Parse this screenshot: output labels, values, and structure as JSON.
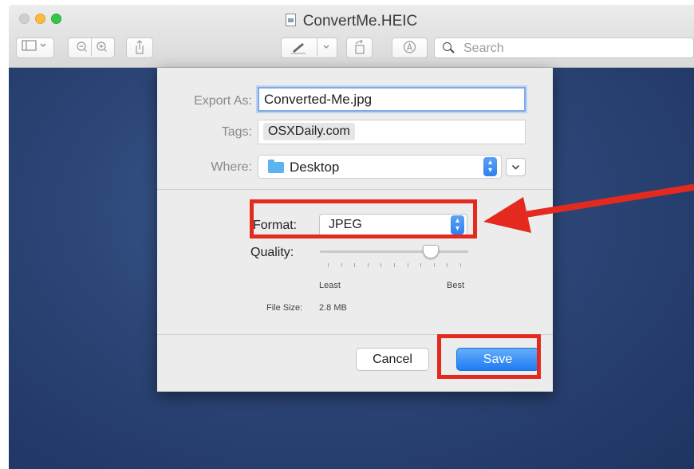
{
  "window": {
    "title": "ConvertMe.HEIC",
    "toolbar": {
      "sidebar_icon": "sidebar-icon",
      "zoom_out_icon": "zoom-out-icon",
      "zoom_in_icon": "zoom-in-icon",
      "share_icon": "share-icon",
      "markup_icon": "pen-icon",
      "rotate_icon": "rotate-icon",
      "annotate_icon": "markup-circle-icon",
      "search_placeholder": "Search"
    }
  },
  "dialog": {
    "export_as_label": "Export As:",
    "export_as_value": "Converted-Me.jpg",
    "tags_label": "Tags:",
    "tag_value": "OSXDaily.com",
    "where_label": "Where:",
    "where_value": "Desktop",
    "format_label": "Format:",
    "format_value": "JPEG",
    "quality_label": "Quality:",
    "quality_level": 0.78,
    "quality_min_label": "Least",
    "quality_max_label": "Best",
    "file_size_label": "File Size:",
    "file_size_value": "2.8 MB",
    "cancel_label": "Cancel",
    "save_label": "Save"
  },
  "annotations": {
    "highlight_color": "#e42a1e"
  }
}
